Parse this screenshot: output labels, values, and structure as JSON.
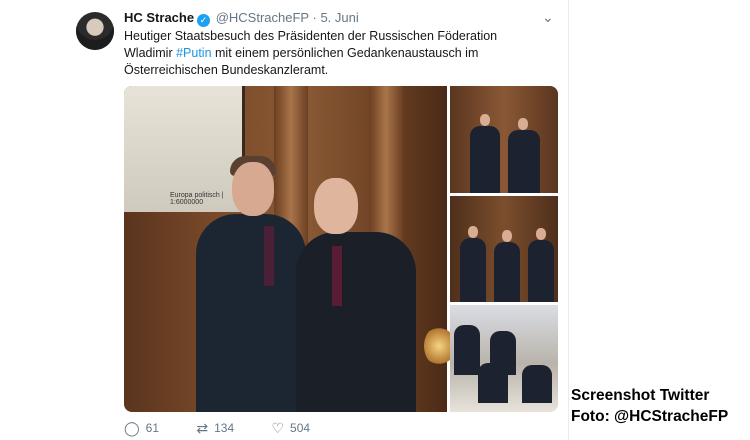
{
  "tweet": {
    "author_name": "HC Strache",
    "handle": "@HCStracheFP",
    "separator": "·",
    "date": "5. Juni",
    "text_before": "Heutiger Staatsbesuch des Präsidenten der Russischen Föderation Wladimir ",
    "hashtag": "#Putin",
    "text_after": " mit einem persönlichen Gedankenaustausch im Österreichischen Bundeskanzleramt.",
    "map_label": "Europa politisch | 1:6000000",
    "actions": {
      "reply_count": "61",
      "retweet_count": "134",
      "like_count": "504"
    },
    "icons": {
      "verified": "verified-badge-icon",
      "menu": "chevron-down-icon",
      "reply": "reply-icon",
      "retweet": "retweet-icon",
      "like": "heart-icon"
    },
    "colors": {
      "link": "#1b95e0",
      "verified": "#1da1f2",
      "muted": "#657786"
    }
  },
  "caption": {
    "line1": "Screenshot Twitter",
    "line2": "Foto: @HCStracheFP"
  }
}
